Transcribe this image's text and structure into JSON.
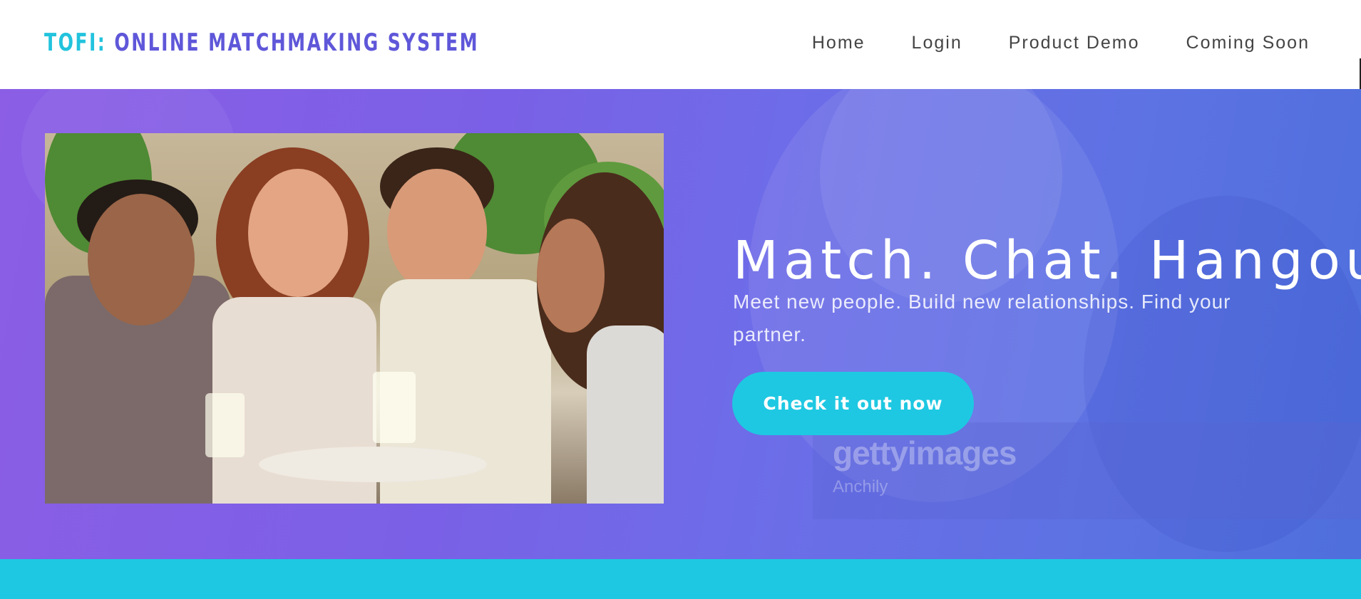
{
  "header": {
    "brand_prefix": "TOFI:",
    "brand_name": "ONLINE MATCHMAKING SYSTEM",
    "nav": [
      {
        "label": "Home"
      },
      {
        "label": "Login"
      },
      {
        "label": "Product Demo"
      },
      {
        "label": "Coming Soon"
      }
    ]
  },
  "hero": {
    "headline": "Match. Chat. Hangout.",
    "subtext": "Meet new people. Build new relationships. Find your partner.",
    "cta_label": "Check it out now",
    "watermark": {
      "brand": "gettyimages",
      "credit": "Anchily"
    }
  },
  "colors": {
    "accent": "#1ec8e2",
    "brand_primary": "#5f57d9",
    "hero_gradient_start": "#8b5ee5",
    "hero_gradient_end": "#4e6fdc"
  }
}
